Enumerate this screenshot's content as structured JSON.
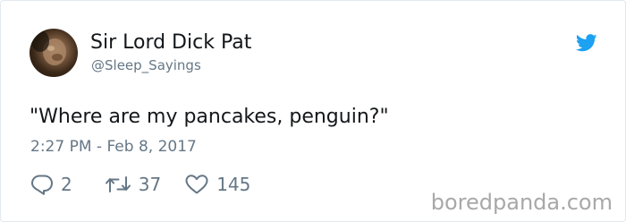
{
  "tweet": {
    "display_name": "Sir Lord Dick Pat",
    "handle": "@Sleep_Sayings",
    "text": "\"Where are my pancakes, penguin?\"",
    "timestamp": "2:27 PM - Feb 8, 2017"
  },
  "actions": {
    "replies": "2",
    "retweets": "37",
    "likes": "145"
  },
  "watermark": "boredpanda.com",
  "icons": {
    "brand": "twitter-bird-icon",
    "reply": "reply-icon",
    "retweet": "retweet-icon",
    "like": "heart-icon"
  },
  "colors": {
    "brand": "#1da1f2",
    "text": "#14171a",
    "secondary": "#657786",
    "watermark": "#a8a8a8"
  }
}
